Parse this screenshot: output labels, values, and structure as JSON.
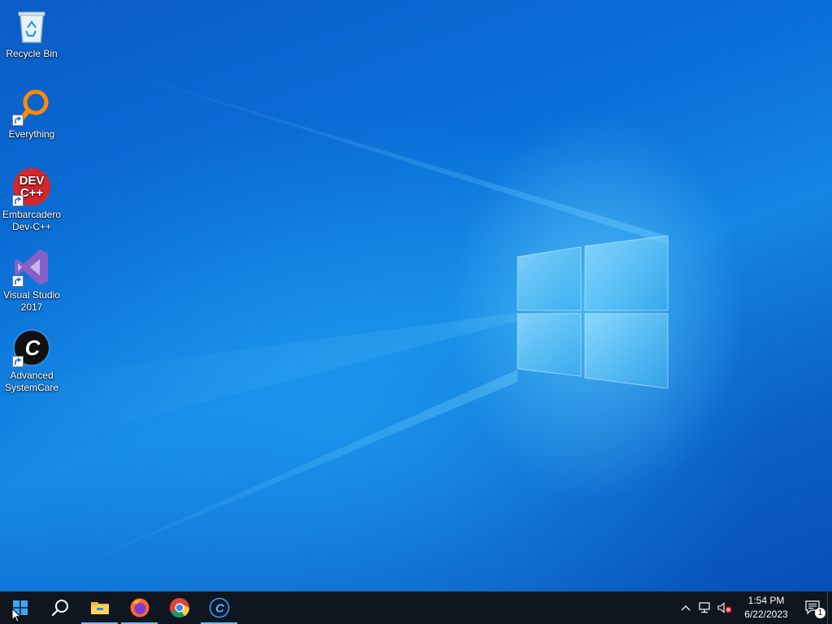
{
  "desktop": {
    "icons": [
      {
        "label": "Recycle Bin",
        "icon": "recycle-bin-icon",
        "shortcut": false
      },
      {
        "label": "Everything",
        "icon": "everything-search-icon",
        "shortcut": true
      },
      {
        "label": "Embarcadero Dev-C++",
        "icon": "devcpp-icon",
        "icon_text_1": "DEV",
        "icon_text_2": "C++",
        "shortcut": true
      },
      {
        "label": "Visual Studio 2017",
        "icon": "visual-studio-icon",
        "shortcut": true
      },
      {
        "label": "Advanced SystemCare",
        "icon": "advanced-systemcare-icon",
        "icon_text": "C",
        "shortcut": true
      }
    ]
  },
  "taskbar": {
    "start": {
      "icon": "windows-logo-icon"
    },
    "search": {
      "icon": "search-icon"
    },
    "pinned": [
      {
        "name": "File Explorer",
        "icon": "file-explorer-icon",
        "active": true
      },
      {
        "name": "Firefox",
        "icon": "firefox-icon",
        "active": true
      },
      {
        "name": "Google Chrome",
        "icon": "chrome-icon",
        "active": false
      },
      {
        "name": "Advanced SystemCare",
        "icon": "advanced-systemcare-icon",
        "icon_text": "C",
        "active": true
      }
    ],
    "tray": {
      "icons": [
        "chevron-up-icon",
        "network-icon",
        "volume-muted-icon"
      ],
      "time": "1:54 PM",
      "date": "6/22/2023",
      "notification_count": "1"
    }
  },
  "colors": {
    "taskbar_bg": "#0f1620",
    "accent": "#76b9ed",
    "wallpaper_blue": "#0a63c9"
  }
}
